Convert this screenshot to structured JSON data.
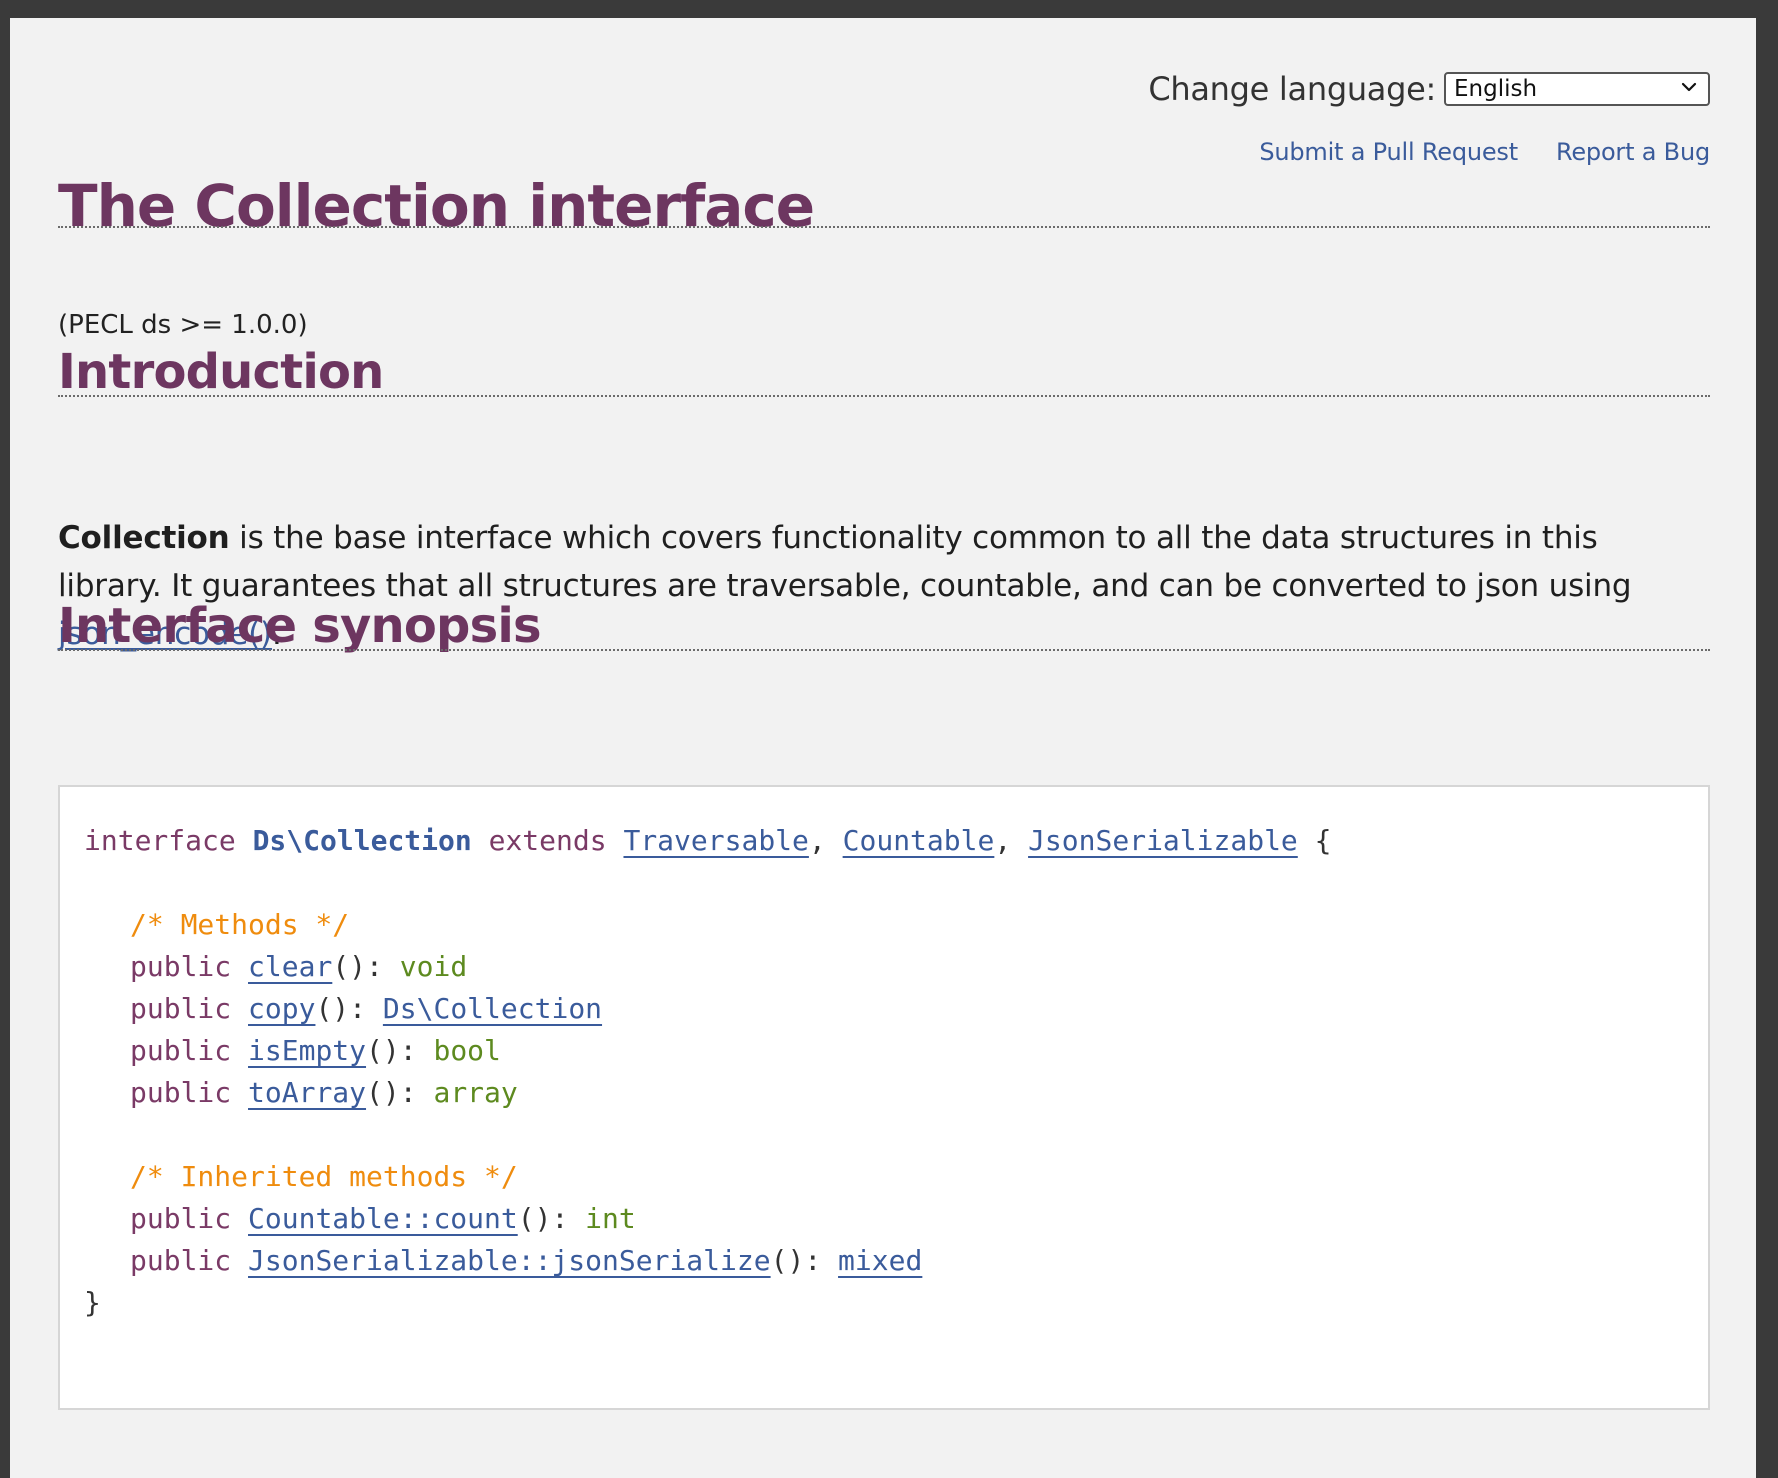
{
  "language": {
    "label": "Change language:",
    "selected": "English"
  },
  "links": {
    "pull_request": "Submit a Pull Request",
    "report_bug": "Report a Bug"
  },
  "page": {
    "title": "The Collection interface",
    "version": "(PECL ds >= 1.0.0)"
  },
  "introduction": {
    "heading": "Introduction",
    "term": "Collection",
    "text_before_link": " is the base interface which covers functionality common to all the data structures in this library. It guarantees that all structures are traversable, countable, and can be converted to json using ",
    "link": "json_encode()",
    "text_after_link": "."
  },
  "synopsis": {
    "heading": "Interface synopsis",
    "kw_interface": "interface",
    "class_name": "Ds\\Collection",
    "kw_extends": "extends",
    "parents": [
      "Traversable",
      "Countable",
      "JsonSerializable"
    ],
    "open_brace": "{",
    "close_brace": "}",
    "comment_methods": "/* Methods */",
    "comment_inherited": "/* Inherited methods */",
    "modifier": "public",
    "methods": [
      {
        "name": "clear",
        "return": "void"
      },
      {
        "name": "copy",
        "return": "Ds\\Collection"
      },
      {
        "name": "isEmpty",
        "return": "bool"
      },
      {
        "name": "toArray",
        "return": "array"
      }
    ],
    "inherited": [
      {
        "name": "Countable::count",
        "return": "int"
      },
      {
        "name": "JsonSerializable::jsonSerialize",
        "return": "mixed"
      }
    ],
    "parens": "(): ",
    "comma": ", "
  },
  "colors": {
    "heading": "#6d3660",
    "link": "#3a5b9b",
    "type": "#5d8a1f",
    "comment": "#ef8c0e",
    "keyword": "#7a3a66"
  }
}
